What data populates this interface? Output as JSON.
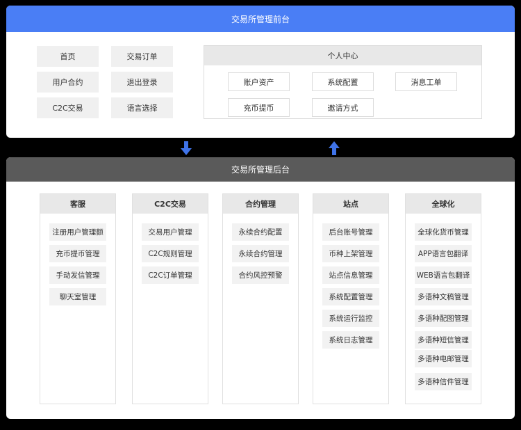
{
  "front": {
    "title": "交易所管理前台",
    "menu": [
      "首页",
      "交易订单",
      "用户合约",
      "退出登录",
      "C2C交易",
      "语言选择"
    ],
    "center": {
      "title": "个人中心",
      "items": [
        "账户资产",
        "系统配置",
        "消息工单",
        "充币提币",
        "邀请方式"
      ]
    }
  },
  "arrows": {
    "down_color": "#3f73e8",
    "up_color": "#3f73e8"
  },
  "back": {
    "title": "交易所管理后台",
    "columns": [
      {
        "title": "客服",
        "items": [
          "注册用户管理额",
          "充币提币管理",
          "手动发信管理",
          "聊天室管理"
        ]
      },
      {
        "title": "C2C交易",
        "items": [
          "交易用户管理",
          "C2C规则管理",
          "C2C订单管理"
        ]
      },
      {
        "title": "合约管理",
        "items": [
          "永续合约配置",
          "永续合约管理",
          "合约风控预警"
        ]
      },
      {
        "title": "站点",
        "items": [
          "后台账号管理",
          "币种上架管理",
          "站点信息管理",
          "系统配置管理",
          "系统运行监控",
          "系统日志管理"
        ]
      },
      {
        "title": "全球化",
        "items": [
          "全球化货币管理",
          "APP语言包翻译",
          "WEB语言包翻译",
          "多语种文稿管理",
          "多语种配图管理",
          "多语种短信管理",
          "多语种电邮管理",
          "多语种信件管理"
        ]
      }
    ]
  }
}
